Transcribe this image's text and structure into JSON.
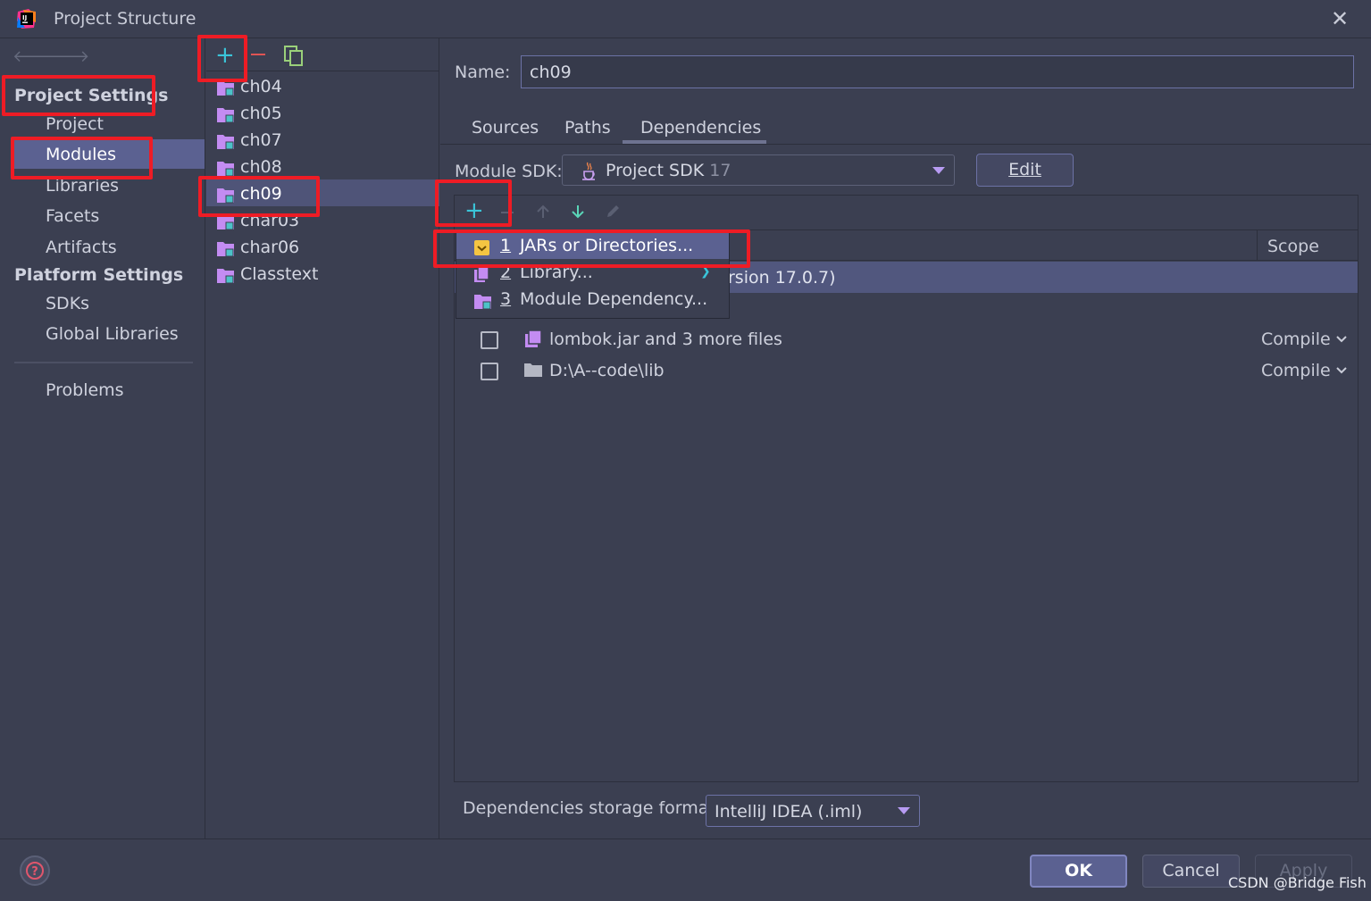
{
  "window": {
    "title": "Project Structure",
    "close": "✕"
  },
  "sidebar": {
    "project_settings": "Project Settings",
    "project_items": [
      "Project",
      "Modules",
      "Libraries",
      "Facets",
      "Artifacts"
    ],
    "platform_settings": "Platform Settings",
    "platform_items": [
      "SDKs",
      "Global Libraries"
    ],
    "problems": "Problems"
  },
  "modules": {
    "items": [
      "ch04",
      "ch05",
      "ch07",
      "ch08",
      "ch09",
      "char03",
      "char06",
      "Classtext"
    ],
    "selected": "ch09"
  },
  "module_panel": {
    "name_label": "Name:",
    "name_value": "ch09",
    "tabs": [
      "Sources",
      "Paths",
      "Dependencies"
    ],
    "active_tab": "Dependencies",
    "sdk_label": "Module SDK:",
    "sdk_value": "Project SDK",
    "sdk_version": "17",
    "edit_button": "Edit"
  },
  "dependencies": {
    "scope_header": "Scope",
    "selected_row_text": "rsion 17.0.7)",
    "rows": [
      {
        "name": "lombok.jar and 3 more files",
        "scope": "Compile"
      },
      {
        "name": "D:\\A--code\\lib",
        "scope": "Compile"
      }
    ],
    "storage_label": "Dependencies storage format:",
    "storage_value": "IntelliJ IDEA (.iml)"
  },
  "add_menu": {
    "items": [
      {
        "num": "1",
        "label": "JARs or Directories..."
      },
      {
        "num": "2",
        "label": "Library..."
      },
      {
        "num": "3",
        "label": "Module Dependency..."
      }
    ]
  },
  "footer": {
    "ok": "OK",
    "cancel": "Cancel",
    "apply": "Apply",
    "help": "?",
    "watermark": "CSDN @Bridge Fish"
  },
  "colors": {
    "background": "#3b3f51",
    "selection": "#5b6191",
    "highlight": "#ee1c25",
    "add_green": "#3ac5d9",
    "remove_red": "#e05454",
    "folder_purple": "#c38cf2"
  }
}
